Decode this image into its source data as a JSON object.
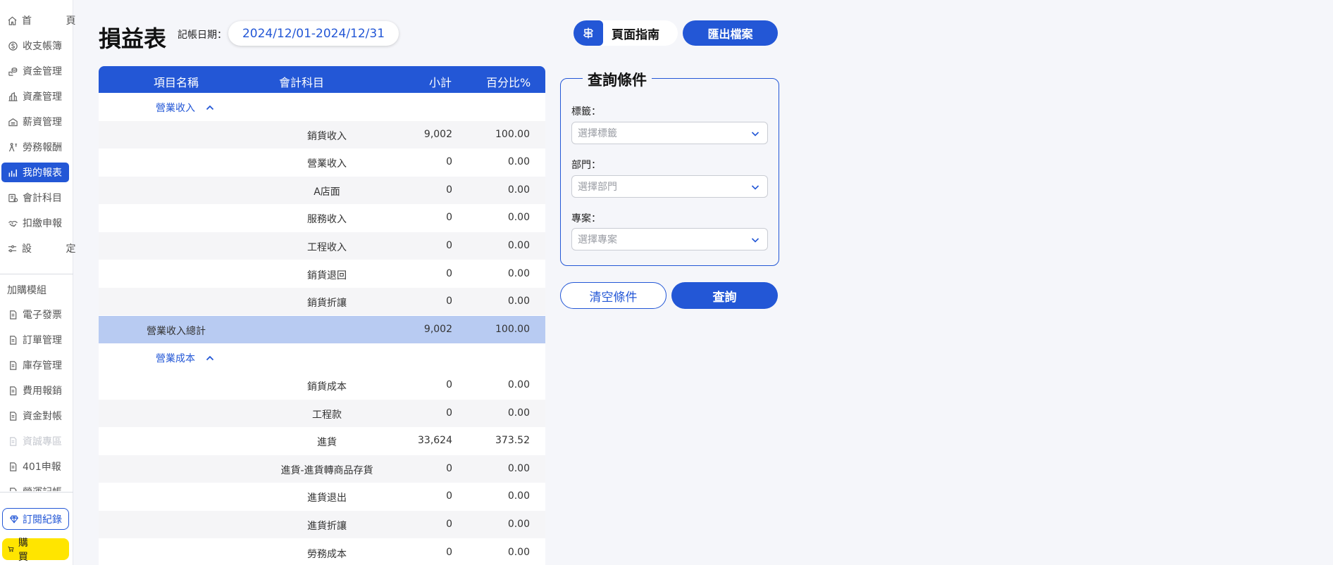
{
  "sidebar": {
    "items": [
      {
        "label": "首 頁",
        "icon": "home-icon",
        "spaced": true
      },
      {
        "label": "收支帳簿",
        "icon": "dollar-circle-icon"
      },
      {
        "label": "資金管理",
        "icon": "coins-icon"
      },
      {
        "label": "資產管理",
        "icon": "building-icon"
      },
      {
        "label": "薪資管理",
        "icon": "payroll-icon"
      },
      {
        "label": "勞務報酬",
        "icon": "worker-icon"
      },
      {
        "label": "我的報表",
        "icon": "bar-chart-icon",
        "active": true
      },
      {
        "label": "會計科目",
        "icon": "ledger-icon"
      },
      {
        "label": "扣繳申報",
        "icon": "handshake-icon"
      },
      {
        "label": "設 定",
        "icon": "sliders-icon",
        "spaced": true
      }
    ],
    "addon_group": "加購模組",
    "addon_items": [
      {
        "label": "電子發票",
        "icon": "document-icon"
      },
      {
        "label": "訂單管理",
        "icon": "document-icon"
      },
      {
        "label": "庫存管理",
        "icon": "document-icon"
      },
      {
        "label": "費用報銷",
        "icon": "document-icon"
      },
      {
        "label": "資金對帳",
        "icon": "document-icon"
      },
      {
        "label": "資誠專區",
        "icon": "document-icon",
        "disabled": true
      },
      {
        "label": "401申報",
        "icon": "document-icon"
      },
      {
        "label": "營運記帳",
        "icon": "document-icon"
      }
    ],
    "subscription": "訂閱紀錄",
    "buy": "購 買"
  },
  "header": {
    "title": "損益表",
    "date_label": "記帳日期：",
    "date_range": "2024/12/01-2024/12/31",
    "guide": "頁面指南",
    "export": "匯出檔案"
  },
  "table": {
    "columns": [
      "項目名稱",
      "會計科目",
      "小計",
      "百分比%"
    ],
    "rows": [
      {
        "type": "section",
        "name": "營業收入"
      },
      {
        "type": "item",
        "account": "銷貨收入",
        "subtotal": "9,002",
        "percent": "100.00"
      },
      {
        "type": "item",
        "account": "營業收入",
        "subtotal": "0",
        "percent": "0.00"
      },
      {
        "type": "item",
        "account": "A店面",
        "subtotal": "0",
        "percent": "0.00"
      },
      {
        "type": "item",
        "account": "服務收入",
        "subtotal": "0",
        "percent": "0.00"
      },
      {
        "type": "item",
        "account": "工程收入",
        "subtotal": "0",
        "percent": "0.00"
      },
      {
        "type": "item",
        "account": "銷貨退回",
        "subtotal": "0",
        "percent": "0.00"
      },
      {
        "type": "item",
        "account": "銷貨折讓",
        "subtotal": "0",
        "percent": "0.00"
      },
      {
        "type": "total",
        "name": "營業收入總計",
        "subtotal": "9,002",
        "percent": "100.00"
      },
      {
        "type": "section",
        "name": "營業成本"
      },
      {
        "type": "item",
        "account": "銷貨成本",
        "subtotal": "0",
        "percent": "0.00"
      },
      {
        "type": "item",
        "account": "工程款",
        "subtotal": "0",
        "percent": "0.00"
      },
      {
        "type": "item",
        "account": "進貨",
        "subtotal": "33,624",
        "percent": "373.52"
      },
      {
        "type": "item",
        "account": "進貨-進貨轉商品存貨",
        "subtotal": "0",
        "percent": "0.00"
      },
      {
        "type": "item",
        "account": "進貨退出",
        "subtotal": "0",
        "percent": "0.00"
      },
      {
        "type": "item",
        "account": "進貨折讓",
        "subtotal": "0",
        "percent": "0.00"
      },
      {
        "type": "item",
        "account": "勞務成本",
        "subtotal": "0",
        "percent": "0.00"
      }
    ]
  },
  "query": {
    "title": "查詢條件",
    "fields": [
      {
        "label": "標籤：",
        "placeholder": "選擇標籤"
      },
      {
        "label": "部門：",
        "placeholder": "選擇部門"
      },
      {
        "label": "專案：",
        "placeholder": "選擇專案"
      }
    ],
    "clear": "清空條件",
    "submit": "查詢"
  },
  "colors": {
    "accent": "#2357d6",
    "total_row": "#b8cbf2",
    "buy_button": "#ffe500"
  }
}
